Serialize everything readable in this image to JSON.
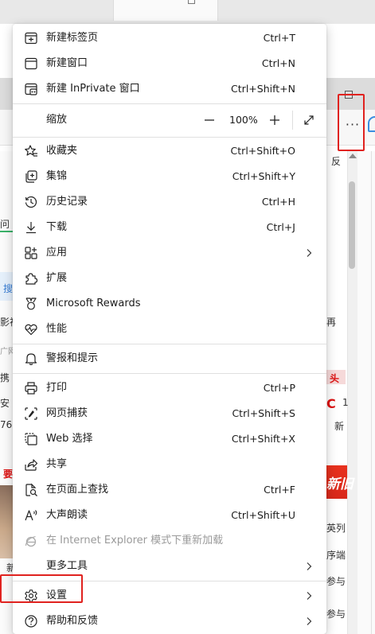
{
  "background": {
    "left_fragments": [
      "问",
      "搜",
      "影视",
      "广网",
      "携",
      "安",
      "76",
      "要",
      "新"
    ],
    "right_fragments": [
      "反",
      "再",
      "头",
      "C",
      "1",
      "新",
      "新旧",
      "英列",
      "序端",
      "参与",
      "参与"
    ]
  },
  "zoom": {
    "label": "缩放",
    "value": "100%"
  },
  "menu": {
    "group1": [
      {
        "label": "新建标签页",
        "shortcut": "Ctrl+T"
      },
      {
        "label": "新建窗口",
        "shortcut": "Ctrl+N"
      },
      {
        "label": "新建 InPrivate 窗口",
        "shortcut": "Ctrl+Shift+N"
      }
    ],
    "group2": [
      {
        "label": "收藏夹",
        "shortcut": "Ctrl+Shift+O"
      },
      {
        "label": "集锦",
        "shortcut": "Ctrl+Shift+Y"
      },
      {
        "label": "历史记录",
        "shortcut": "Ctrl+H"
      },
      {
        "label": "下载",
        "shortcut": "Ctrl+J"
      },
      {
        "label": "应用",
        "shortcut": ""
      },
      {
        "label": "扩展",
        "shortcut": ""
      },
      {
        "label": "Microsoft Rewards",
        "shortcut": ""
      },
      {
        "label": "性能",
        "shortcut": ""
      }
    ],
    "group3": [
      {
        "label": "警报和提示",
        "shortcut": ""
      }
    ],
    "group4": [
      {
        "label": "打印",
        "shortcut": "Ctrl+P"
      },
      {
        "label": "网页捕获",
        "shortcut": "Ctrl+Shift+S"
      },
      {
        "label": "Web 选择",
        "shortcut": "Ctrl+Shift+X"
      },
      {
        "label": "共享",
        "shortcut": ""
      },
      {
        "label": "在页面上查找",
        "shortcut": "Ctrl+F"
      },
      {
        "label": "大声朗读",
        "shortcut": "Ctrl+Shift+U"
      },
      {
        "label": "在 Internet Explorer 模式下重新加载",
        "shortcut": ""
      },
      {
        "label": "更多工具",
        "shortcut": ""
      }
    ],
    "group5": [
      {
        "label": "设置",
        "shortcut": ""
      },
      {
        "label": "帮助和反馈",
        "shortcut": ""
      }
    ]
  },
  "highlight_color": "#e0221f",
  "accent_color": "#3a8de0"
}
